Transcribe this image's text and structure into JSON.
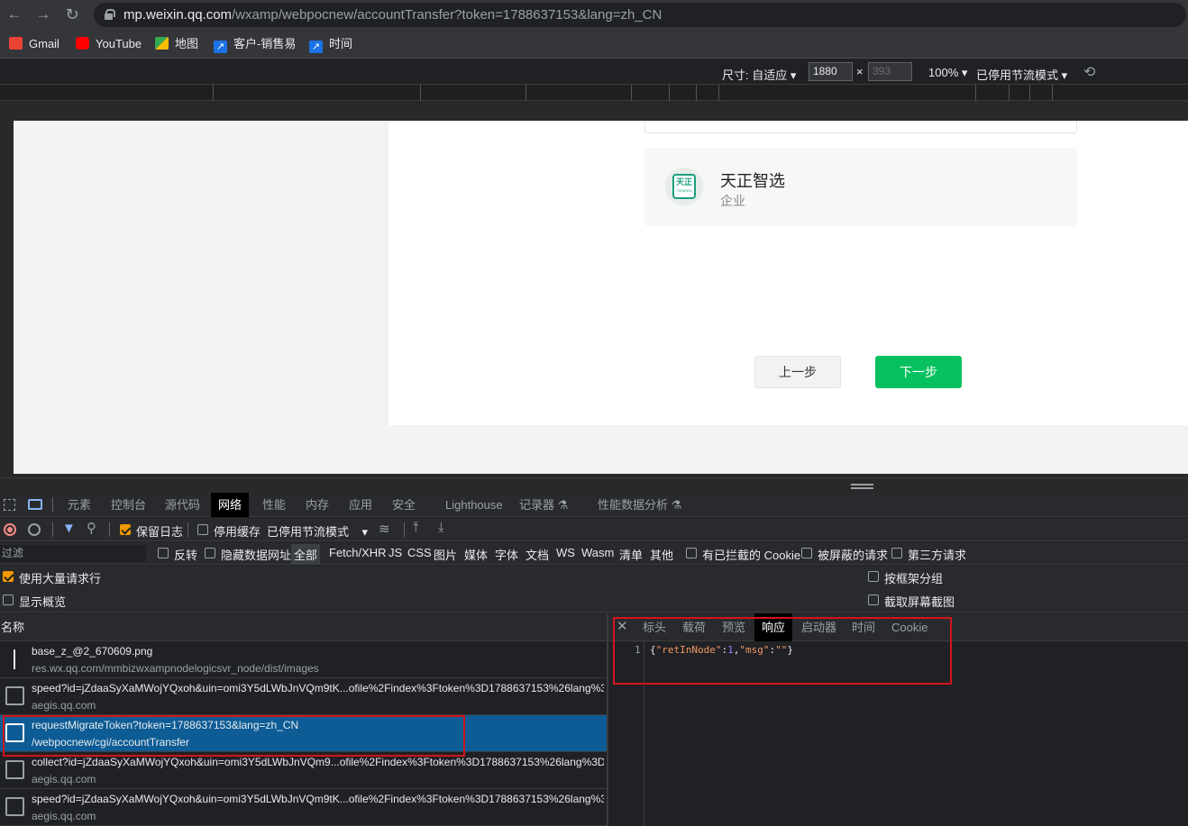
{
  "browser": {
    "url_host": "mp.weixin.qq.com",
    "url_path": "/wxamp/webpocnew/accountTransfer?token=1788637153&lang=zh_CN",
    "bookmarks": [
      {
        "label": "Gmail",
        "icon": "gmail-icon",
        "color": "#ea4335"
      },
      {
        "label": "YouTube",
        "icon": "youtube-icon",
        "color": "#ff0000"
      },
      {
        "label": "地图",
        "icon": "maps-icon",
        "color": "#34a853"
      },
      {
        "label": "客户-销售易",
        "icon": "arrow-link-icon",
        "color": "#1a73e8"
      },
      {
        "label": "时间",
        "icon": "arrow-link-icon",
        "color": "#1a73e8"
      }
    ]
  },
  "device_toolbar": {
    "size_label": "尺寸: 自适应",
    "width": "1880",
    "height_placeholder": "393",
    "times": "×",
    "zoom": "100%",
    "throttle": "已停用节流模式"
  },
  "page": {
    "company_name": "天正智选",
    "company_type": "企业",
    "logo_text": "天正",
    "logo_subtext": "TIENZEN",
    "prev_button": "上一步",
    "next_button": "下一步"
  },
  "devtools": {
    "tabs": [
      "元素",
      "控制台",
      "源代码",
      "网络",
      "性能",
      "内存",
      "应用",
      "安全",
      "Lighthouse",
      "记录器 ⚗",
      "性能数据分析 ⚗"
    ],
    "active_tab": "网络",
    "controls": {
      "preserve_log": "保留日志",
      "disable_cache": "停用缓存",
      "throttle": "已停用节流模式"
    },
    "filter": {
      "placeholder": "过滤",
      "invert": "反转",
      "hide_data_urls": "隐藏数据网址",
      "types": [
        "全部",
        "Fetch/XHR",
        "JS",
        "CSS",
        "图片",
        "媒体",
        "字体",
        "文档",
        "WS",
        "Wasm",
        "清单",
        "其他"
      ],
      "blocked_cookies": "有已拦截的 Cookie",
      "blocked_requests": "被屏蔽的请求",
      "third_party": "第三方请求"
    },
    "options": {
      "large_rows": "使用大量请求行",
      "show_overview": "显示概览",
      "group_by_frame": "按框架分组",
      "capture_screenshots": "截取屏幕截图"
    },
    "column_name": "名称",
    "requests": [
      {
        "name": "base_z_@2_670609.png",
        "domain": "res.wx.qq.com/mmbizwxampnodelogicsvr_node/dist/images"
      },
      {
        "name": "speed?id=jZdaaSyXaMWojYQxoh&uin=omi3Y5dLWbJnVQm9tK...ofile%2Findex%3Ftoken%3D1788637153%26lang%3...",
        "domain": "aegis.qq.com"
      },
      {
        "name": "requestMigrateToken?token=1788637153&lang=zh_CN",
        "domain": "/webpocnew/cgi/accountTransfer"
      },
      {
        "name": "collect?id=jZdaaSyXaMWojYQxoh&uin=omi3Y5dLWbJnVQm9...ofile%2Findex%3Ftoken%3D1788637153%26lang%3D...",
        "domain": "aegis.qq.com"
      },
      {
        "name": "speed?id=jZdaaSyXaMWojYQxoh&uin=omi3Y5dLWbJnVQm9tK...ofile%2Findex%3Ftoken%3D1788637153%26lang%3...",
        "domain": "aegis.qq.com"
      }
    ],
    "detail_tabs": [
      "标头",
      "载荷",
      "预览",
      "响应",
      "启动器",
      "时间",
      "Cookie"
    ],
    "active_detail_tab": "响应",
    "response": {
      "line_number": "1",
      "brace_open": "{",
      "key1": "\"retInNode\"",
      "colon1": ":",
      "val1": "1",
      "comma": ",",
      "key2": "\"msg\"",
      "colon2": ":",
      "val2": "\"\"",
      "brace_close": "}"
    }
  },
  "colors": {
    "accent_green": "#07c160",
    "selected_row": "#0e5c95",
    "highlight_red": "#d0151b",
    "checkbox_orange": "#f29900"
  }
}
